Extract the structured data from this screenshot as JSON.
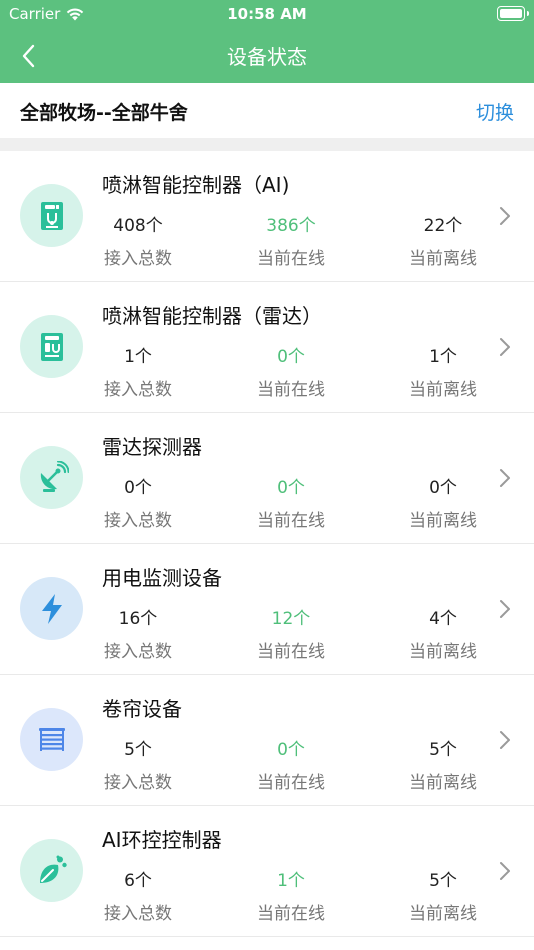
{
  "status_bar": {
    "carrier": "Carrier",
    "time": "10:58 AM"
  },
  "nav": {
    "title": "设备状态"
  },
  "filter": {
    "label": "全部牧场--全部牛舍",
    "switch_label": "切换"
  },
  "stat_labels": {
    "total": "接入总数",
    "online": "当前在线",
    "offline": "当前离线"
  },
  "devices": [
    {
      "name": "喷淋智能控制器（AI)",
      "icon": "sprinkler-controller-icon",
      "total": "408个",
      "online": "386个",
      "offline": "22个"
    },
    {
      "name": "喷淋智能控制器（雷达）",
      "icon": "sprinkler-radar-controller-icon",
      "total": "1个",
      "online": "0个",
      "offline": "1个"
    },
    {
      "name": "雷达探测器",
      "icon": "radar-dish-icon",
      "total": "0个",
      "online": "0个",
      "offline": "0个"
    },
    {
      "name": "用电监测设备",
      "icon": "lightning-icon",
      "total": "16个",
      "online": "12个",
      "offline": "4个"
    },
    {
      "name": "卷帘设备",
      "icon": "roller-blind-icon",
      "total": "5个",
      "online": "0个",
      "offline": "5个"
    },
    {
      "name": "AI环控控制器",
      "icon": "leaf-environment-icon",
      "total": "6个",
      "online": "1个",
      "offline": "5个"
    }
  ],
  "colors": {
    "header_green": "#5cc17f",
    "online_green": "#4fbf7a",
    "link_blue": "#2d8fdc"
  }
}
